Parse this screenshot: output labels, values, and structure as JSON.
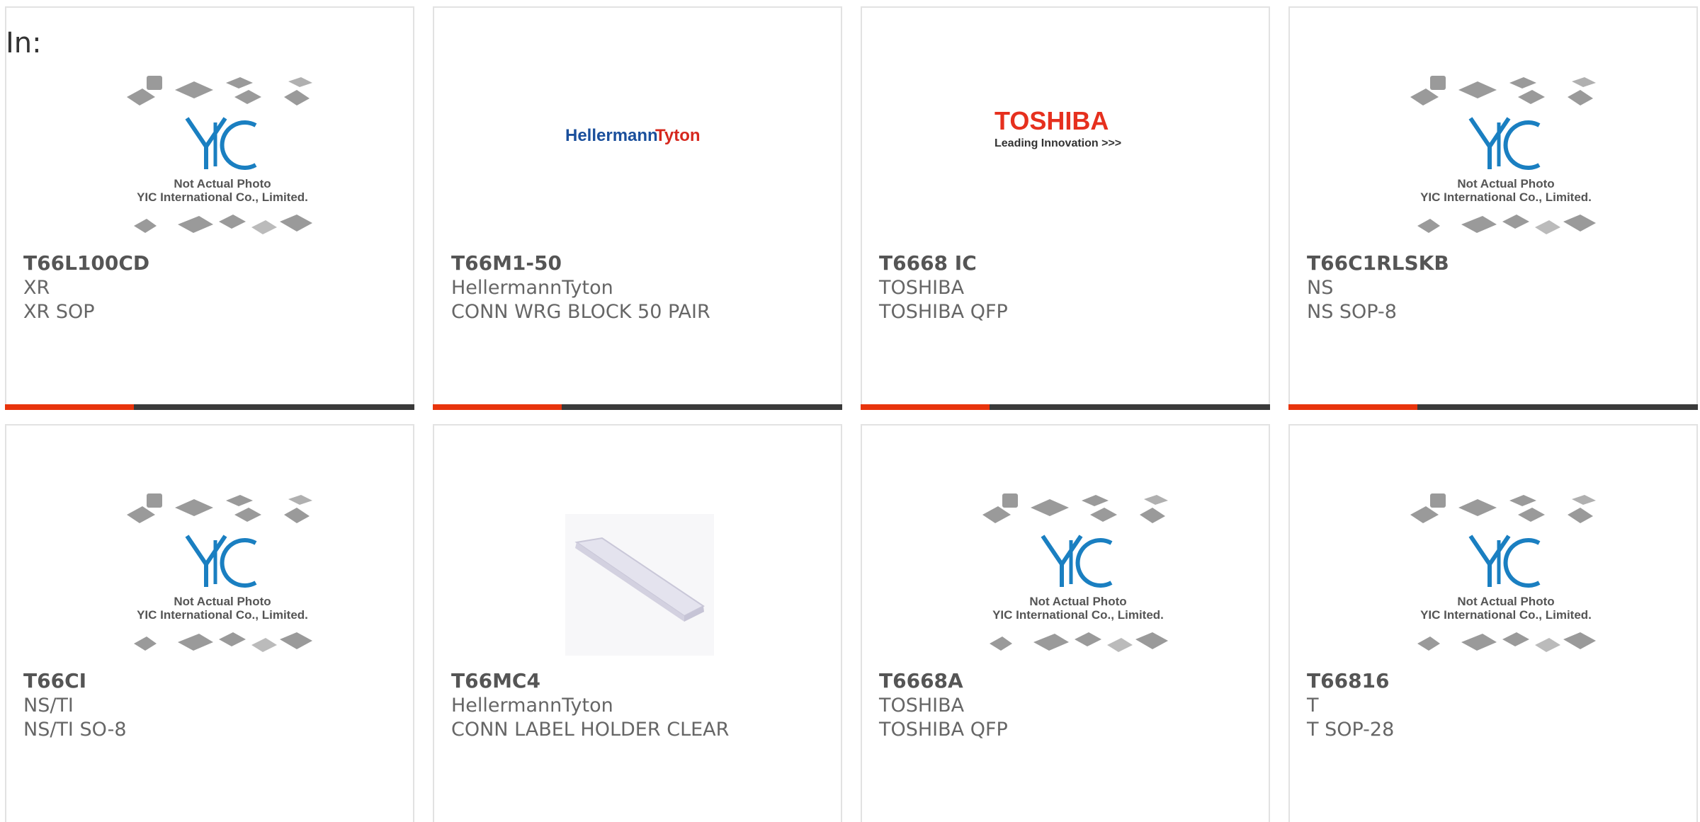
{
  "header": {
    "label": "In:"
  },
  "placeholder": {
    "line1": "Not Actual Photo",
    "line2": "YIC International Co., Limited.",
    "logo": "YIC"
  },
  "colors": {
    "accent": "#e8340c",
    "bar": "#3a3a3a",
    "yic_blue": "#1a7fc1"
  },
  "products": [
    {
      "part": "T66L100CD",
      "manufacturer": "XR",
      "description": "XR SOP",
      "image": "placeholder"
    },
    {
      "part": "T66M1-50",
      "manufacturer": "HellermannTyton",
      "description": "CONN WRG BLOCK 50 PAIR",
      "image": "hellermann-logo",
      "logo_a": "Hellermann",
      "logo_b": "Tyton"
    },
    {
      "part": "T6668 IC",
      "manufacturer": "TOSHIBA",
      "description": "TOSHIBA QFP",
      "image": "toshiba-logo",
      "logo_a": "TOSHIBA",
      "logo_b": "Leading Innovation >>>"
    },
    {
      "part": "T66C1RLSKB",
      "manufacturer": "NS",
      "description": "NS SOP-8",
      "image": "placeholder"
    },
    {
      "part": "T66CI",
      "manufacturer": "NS/TI",
      "description": "NS/TI SO-8",
      "image": "placeholder"
    },
    {
      "part": "T66MC4",
      "manufacturer": "HellermannTyton",
      "description": "CONN LABEL HOLDER CLEAR",
      "image": "label-holder-photo"
    },
    {
      "part": "T6668A",
      "manufacturer": "TOSHIBA",
      "description": "TOSHIBA QFP",
      "image": "placeholder"
    },
    {
      "part": "T66816",
      "manufacturer": "T",
      "description": "T SOP-28",
      "image": "placeholder"
    }
  ]
}
